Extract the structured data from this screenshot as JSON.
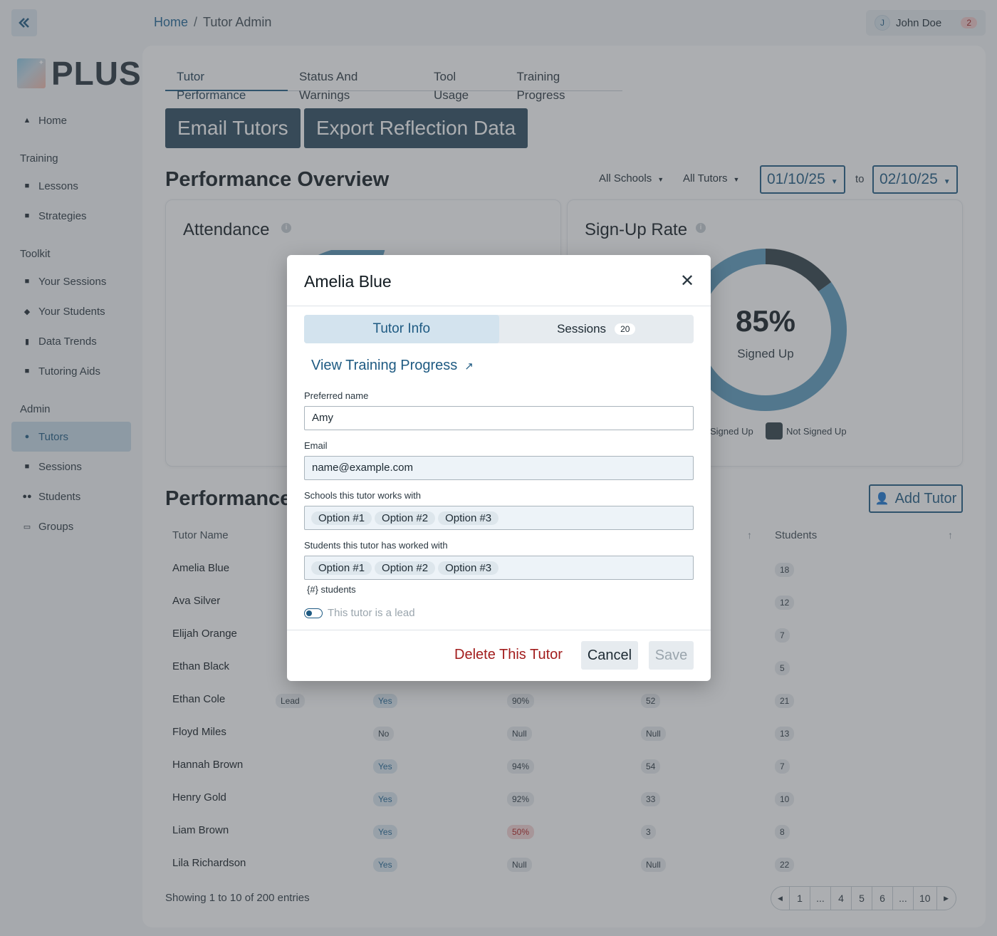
{
  "breadcrumb": {
    "home": "Home",
    "separator": "/",
    "current": "Tutor Admin"
  },
  "user": {
    "initial": "J",
    "name": "John Doe",
    "count": "2"
  },
  "logo_text": "PLUS",
  "sidebar": {
    "home": "Home",
    "sections": [
      {
        "title": "Training",
        "items": [
          "Lessons",
          "Strategies"
        ]
      },
      {
        "title": "Toolkit",
        "items": [
          "Your Sessions",
          "Your Students",
          "Data Trends",
          "Tutoring Aids"
        ]
      },
      {
        "title": "Admin",
        "items": [
          "Tutors",
          "Sessions",
          "Students",
          "Groups"
        ]
      }
    ],
    "active": "Tutors"
  },
  "tabs": [
    "Tutor Performance",
    "Status And Warnings",
    "Tool Usage",
    "Training Progress"
  ],
  "actions": {
    "email": "Email Tutors",
    "export": "Export Reflection Data"
  },
  "overview": {
    "title": "Performance Overview",
    "filter_schools": "All Schools",
    "filter_tutors": "All Tutors",
    "date_from": "01/10/25",
    "date_to_label": "to",
    "date_to": "02/10/25"
  },
  "cards": {
    "attendance_title": "Attendance",
    "signup_title": "Sign-Up Rate",
    "signup_value": "85%",
    "signup_label": "Signed Up",
    "legend_signed": "Signed Up",
    "legend_not": "Not Signed Up"
  },
  "chart_data": [
    {
      "type": "pie",
      "title": "Sign-Up Rate",
      "categories": [
        "Signed Up",
        "Not Signed Up"
      ],
      "values": [
        85,
        15
      ]
    }
  ],
  "table": {
    "title": "Performance I",
    "add_button": "Add Tutor",
    "col_name": "Tutor Name",
    "col_students": "Students",
    "rows": [
      {
        "name": "Amelia Blue",
        "students": "18"
      },
      {
        "name": "Ava Silver",
        "students": "12"
      },
      {
        "name": "Elijah Orange",
        "students": "7"
      },
      {
        "name": "Ethan Black",
        "students": "5"
      },
      {
        "name": "Ethan Cole",
        "lead": "Lead",
        "signed": "Yes",
        "rate": "90%",
        "sessions": "52",
        "students": "21"
      },
      {
        "name": "Floyd Miles",
        "signed": "No",
        "rate": "Null",
        "sessions": "Null",
        "students": "13"
      },
      {
        "name": "Hannah Brown",
        "signed": "Yes",
        "rate": "94%",
        "sessions": "54",
        "students": "7"
      },
      {
        "name": "Henry Gold",
        "signed": "Yes",
        "rate": "92%",
        "sessions": "33",
        "students": "10"
      },
      {
        "name": "Liam Brown",
        "signed": "Yes",
        "rate": "50%",
        "sessions": "3",
        "students": "8"
      },
      {
        "name": "Lila Richardson",
        "signed": "Yes",
        "rate": "Null",
        "sessions": "Null",
        "students": "22"
      }
    ],
    "showing": "Showing 1 to 10 of 200 entries",
    "pages": [
      "1",
      "...",
      "4",
      "5",
      "6",
      "...",
      "10"
    ]
  },
  "modal": {
    "title": "Amelia Blue",
    "tab_info": "Tutor Info",
    "tab_sessions": "Sessions",
    "sessions_count": "20",
    "training_link": "View Training Progress",
    "preferred_label": "Preferred name",
    "preferred_value": "Amy",
    "email_label": "Email",
    "email_placeholder": "name@example.com",
    "schools_label": "Schools this tutor works with",
    "schools": [
      "Option #1",
      "Option #2",
      "Option #3"
    ],
    "students_label": "Students this tutor has worked with",
    "students": [
      "Option #1",
      "Option #2",
      "Option #3"
    ],
    "students_hint": "{#} students",
    "lead_label": "This tutor is a lead",
    "delete": "Delete This Tutor",
    "cancel": "Cancel",
    "save": "Save"
  }
}
